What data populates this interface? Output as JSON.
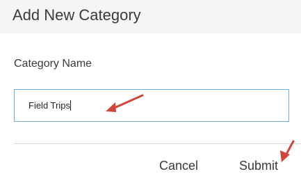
{
  "dialog": {
    "title": "Add New Category",
    "field_label": "Category Name",
    "field_value": "Field Trips",
    "cancel_label": "Cancel",
    "submit_label": "Submit"
  },
  "colors": {
    "header_background": "#f5f5f5",
    "input_border": "#6aaee0",
    "annotation_arrow": "#d0463b"
  },
  "annotations": [
    {
      "name": "arrow",
      "points_to": "category-name-input"
    },
    {
      "name": "arrow",
      "points_to": "submit-button"
    }
  ]
}
